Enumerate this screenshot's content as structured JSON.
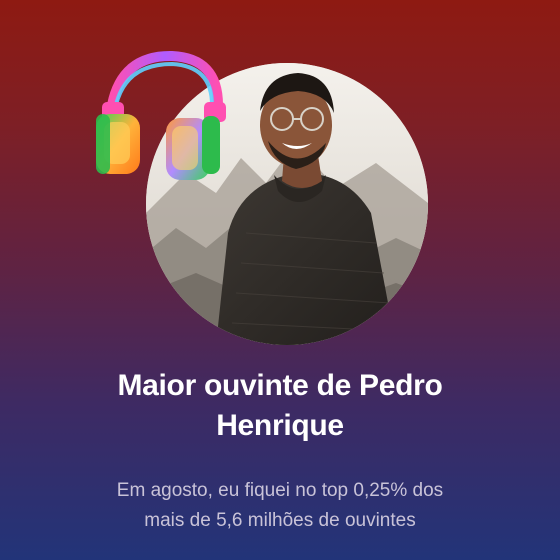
{
  "card": {
    "title_line1": "Maior ouvinte de Pedro",
    "title_line2": "Henrique",
    "subtitle_line1": "Em agosto, eu fiquei no top 0,25% dos",
    "subtitle_line2": "mais de 5,6 milhões de ouvintes"
  },
  "colors": {
    "gradient_top": "#8e1a12",
    "gradient_bottom": "#223479",
    "title_color": "#ffffff",
    "subtitle_color": "#c9c3d8"
  },
  "icons": {
    "sticker": "headphones-icon"
  }
}
